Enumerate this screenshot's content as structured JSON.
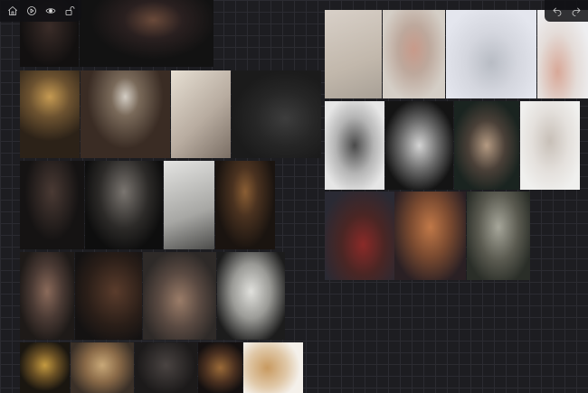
{
  "toolbar": {
    "left": [
      {
        "icon": "home-icon"
      },
      {
        "icon": "play-icon"
      },
      {
        "icon": "eye-icon"
      },
      {
        "icon": "unlock-icon"
      }
    ],
    "right": [
      {
        "icon": "undo-icon"
      },
      {
        "icon": "redo-icon"
      }
    ]
  },
  "board": {
    "background": "#1d1d21",
    "grid_line_color": "#2b2b31",
    "left_cluster_items": 24,
    "right_cluster_items": 11
  }
}
